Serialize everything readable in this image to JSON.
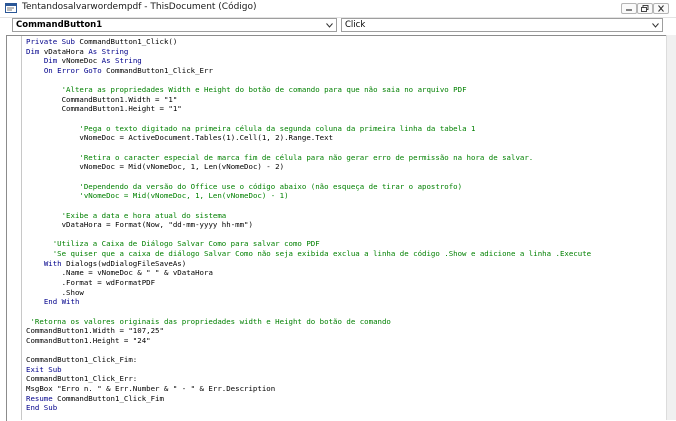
{
  "window": {
    "title": "Tentandosalvarwordempdf - ThisDocument (Código)"
  },
  "object_combo": {
    "value": "CommandButton1"
  },
  "procedure_combo": {
    "value": "Click"
  },
  "code_lines": [
    {
      "indent": 0,
      "parts": [
        {
          "t": "kw",
          "v": "Private Sub "
        },
        {
          "t": "n",
          "v": "CommandButton1_Click()"
        }
      ]
    },
    {
      "indent": 0,
      "parts": [
        {
          "t": "kw",
          "v": "Dim "
        },
        {
          "t": "n",
          "v": "vDataHora "
        },
        {
          "t": "kw",
          "v": "As String"
        }
      ]
    },
    {
      "indent": 4,
      "parts": [
        {
          "t": "kw",
          "v": "Dim "
        },
        {
          "t": "n",
          "v": "vNomeDoc "
        },
        {
          "t": "kw",
          "v": "As String"
        }
      ]
    },
    {
      "indent": 4,
      "parts": [
        {
          "t": "kw",
          "v": "On Error GoTo "
        },
        {
          "t": "n",
          "v": "CommandButton1_Click_Err"
        }
      ]
    },
    {
      "indent": 0,
      "parts": []
    },
    {
      "indent": 8,
      "parts": [
        {
          "t": "cm",
          "v": "'Altera as propriedades Width e Height do botão de comando para que não saia no arquivo PDF"
        }
      ]
    },
    {
      "indent": 8,
      "parts": [
        {
          "t": "n",
          "v": "CommandButton1.Width = \"1\""
        }
      ]
    },
    {
      "indent": 8,
      "parts": [
        {
          "t": "n",
          "v": "CommandButton1.Height = \"1\""
        }
      ]
    },
    {
      "indent": 0,
      "parts": []
    },
    {
      "indent": 12,
      "parts": [
        {
          "t": "cm",
          "v": "'Pega o texto digitado na primeira célula da segunda coluna da primeira linha da tabela 1"
        }
      ]
    },
    {
      "indent": 12,
      "parts": [
        {
          "t": "n",
          "v": "vNomeDoc = ActiveDocument.Tables(1).Cell(1, 2).Range.Text"
        }
      ]
    },
    {
      "indent": 0,
      "parts": []
    },
    {
      "indent": 12,
      "parts": [
        {
          "t": "cm",
          "v": "'Retira o caracter especial de marca fim de célula para não gerar erro de permissão na hora de salvar."
        }
      ]
    },
    {
      "indent": 12,
      "parts": [
        {
          "t": "n",
          "v": "vNomeDoc = Mid(vNomeDoc, 1, Len(vNomeDoc) - 2)"
        }
      ]
    },
    {
      "indent": 0,
      "parts": []
    },
    {
      "indent": 12,
      "parts": [
        {
          "t": "cm",
          "v": "'Dependendo da versão do Office use o código abaixo (não esqueça de tirar o apostrofo)"
        }
      ]
    },
    {
      "indent": 12,
      "parts": [
        {
          "t": "cm",
          "v": "'vNomeDoc = Mid(vNomeDoc, 1, Len(vNomeDoc) - 1)"
        }
      ]
    },
    {
      "indent": 0,
      "parts": []
    },
    {
      "indent": 8,
      "parts": [
        {
          "t": "cm",
          "v": "'Exibe a data e hora atual do sistema"
        }
      ]
    },
    {
      "indent": 8,
      "parts": [
        {
          "t": "n",
          "v": "vDataHora = Format(Now, \"dd-mm-yyyy hh-mm\")"
        }
      ]
    },
    {
      "indent": 0,
      "parts": []
    },
    {
      "indent": 6,
      "parts": [
        {
          "t": "cm",
          "v": "'Utiliza a Caixa de Diálogo Salvar Como para salvar como PDF"
        }
      ]
    },
    {
      "indent": 6,
      "parts": [
        {
          "t": "cm",
          "v": "'Se quiser que a caixa de diálogo Salvar Como não seja exibida exclua a linha de código .Show e adicione a linha .Execute"
        }
      ]
    },
    {
      "indent": 4,
      "parts": [
        {
          "t": "kw",
          "v": "With "
        },
        {
          "t": "n",
          "v": "Dialogs(wdDialogFileSaveAs)"
        }
      ]
    },
    {
      "indent": 8,
      "parts": [
        {
          "t": "n",
          "v": ".Name = vNomeDoc & \" \" & vDataHora"
        }
      ]
    },
    {
      "indent": 8,
      "parts": [
        {
          "t": "n",
          "v": ".Format = wdFormatPDF"
        }
      ]
    },
    {
      "indent": 8,
      "parts": [
        {
          "t": "n",
          "v": ".Show"
        }
      ]
    },
    {
      "indent": 4,
      "parts": [
        {
          "t": "kw",
          "v": "End With"
        }
      ]
    },
    {
      "indent": 0,
      "parts": []
    },
    {
      "indent": 1,
      "parts": [
        {
          "t": "cm",
          "v": "'Retorna os valores originais das propriedades width e Height do botão de comando"
        }
      ]
    },
    {
      "indent": 0,
      "parts": [
        {
          "t": "n",
          "v": "CommandButton1.Width = \"107,25\""
        }
      ]
    },
    {
      "indent": 0,
      "parts": [
        {
          "t": "n",
          "v": "CommandButton1.Height = \"24\""
        }
      ]
    },
    {
      "indent": 0,
      "parts": []
    },
    {
      "indent": 0,
      "parts": [
        {
          "t": "n",
          "v": "CommandButton1_Click_Fim:"
        }
      ]
    },
    {
      "indent": 0,
      "parts": [
        {
          "t": "kw",
          "v": "Exit Sub"
        }
      ]
    },
    {
      "indent": 0,
      "parts": [
        {
          "t": "n",
          "v": "CommandButton1_Click_Err:"
        }
      ]
    },
    {
      "indent": 0,
      "parts": [
        {
          "t": "n",
          "v": "MsgBox \"Erro n. \" & Err.Number & \" - \" & Err.Description"
        }
      ]
    },
    {
      "indent": 0,
      "parts": [
        {
          "t": "kw",
          "v": "Resume "
        },
        {
          "t": "n",
          "v": "CommandButton1_Click_Fim"
        }
      ]
    },
    {
      "indent": 0,
      "parts": [
        {
          "t": "kw",
          "v": "End Sub"
        }
      ]
    }
  ],
  "colors": {
    "keyword": "#00008b",
    "comment": "#008000",
    "text": "#000000"
  }
}
